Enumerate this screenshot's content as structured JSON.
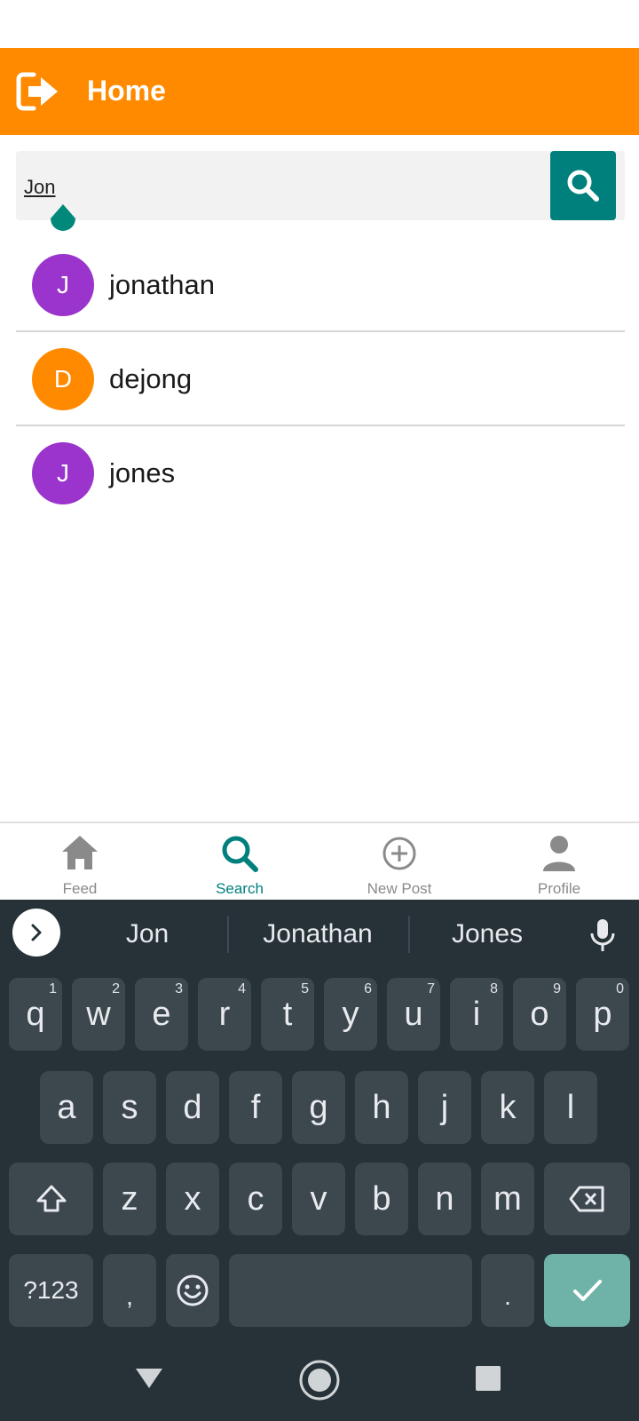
{
  "header": {
    "title": "Home",
    "logout_icon": "logout-icon",
    "color": "#FF8A00"
  },
  "search": {
    "value": "Jon",
    "button_icon": "search-icon",
    "button_color": "#00807C"
  },
  "results": [
    {
      "initial": "J",
      "name": "jonathan",
      "avatar_color": "#9A34CC"
    },
    {
      "initial": "D",
      "name": "dejong",
      "avatar_color": "#FF8A00"
    },
    {
      "initial": "J",
      "name": "jones",
      "avatar_color": "#9A34CC"
    }
  ],
  "bottom_nav": {
    "items": [
      {
        "label": "Feed",
        "icon": "home-icon",
        "active": false
      },
      {
        "label": "Search",
        "icon": "search-icon",
        "active": true
      },
      {
        "label": "New Post",
        "icon": "add-circle-icon",
        "active": false
      },
      {
        "label": "Profile",
        "icon": "person-icon",
        "active": false
      }
    ],
    "active_color": "#00807C"
  },
  "keyboard": {
    "suggestions": [
      "Jon",
      "Jonathan",
      "Jones"
    ],
    "row1": [
      {
        "key": "q",
        "hint": "1"
      },
      {
        "key": "w",
        "hint": "2"
      },
      {
        "key": "e",
        "hint": "3"
      },
      {
        "key": "r",
        "hint": "4"
      },
      {
        "key": "t",
        "hint": "5"
      },
      {
        "key": "y",
        "hint": "6"
      },
      {
        "key": "u",
        "hint": "7"
      },
      {
        "key": "i",
        "hint": "8"
      },
      {
        "key": "o",
        "hint": "9"
      },
      {
        "key": "p",
        "hint": "0"
      }
    ],
    "row2": [
      "a",
      "s",
      "d",
      "f",
      "g",
      "h",
      "j",
      "k",
      "l"
    ],
    "row3": [
      "z",
      "x",
      "c",
      "v",
      "b",
      "n",
      "m"
    ],
    "symbols_label": "?123",
    "comma": ",",
    "period": ".",
    "background": "#263238"
  }
}
